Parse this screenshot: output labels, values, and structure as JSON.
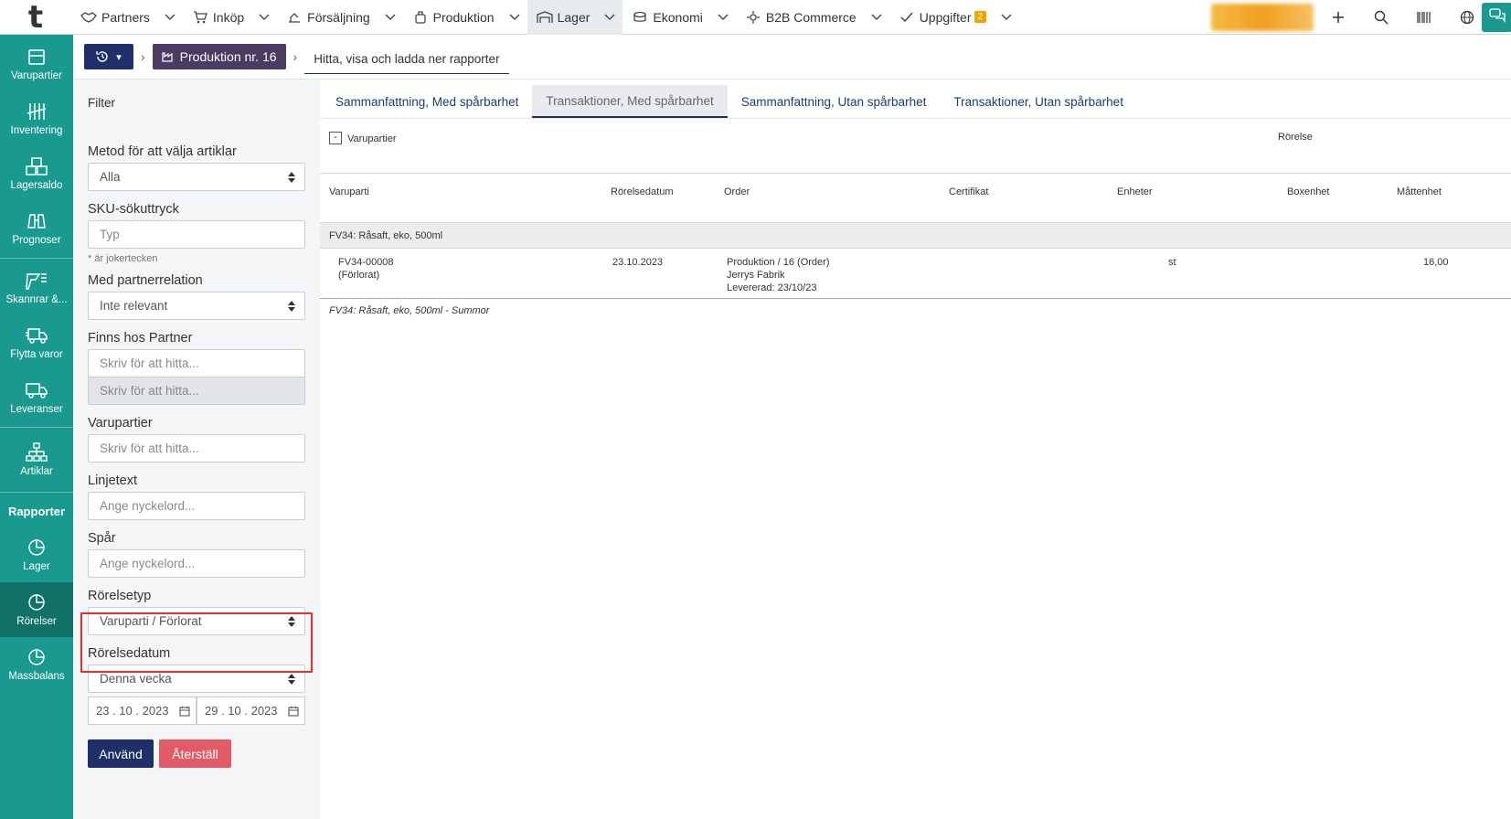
{
  "app": {
    "logo": "t"
  },
  "nav": {
    "items": [
      {
        "label": "Partners",
        "icon": "handshake-icon"
      },
      {
        "label": "Inköp",
        "icon": "cart-icon"
      },
      {
        "label": "Försäljning",
        "icon": "sales-icon"
      },
      {
        "label": "Produktion",
        "icon": "pot-icon"
      },
      {
        "label": "Lager",
        "icon": "warehouse-icon"
      },
      {
        "label": "Ekonomi",
        "icon": "coins-icon"
      },
      {
        "label": "B2B Commerce",
        "icon": "b2b-icon"
      },
      {
        "label": "Uppgifter",
        "icon": "check-icon",
        "badge": "2"
      }
    ],
    "active": "Lager"
  },
  "sidebar": {
    "items": [
      {
        "label": "Varupartier",
        "icon": "box-icon"
      },
      {
        "label": "Inventering",
        "icon": "tally-icon"
      },
      {
        "label": "Lagersaldo",
        "icon": "boxes-icon"
      },
      {
        "label": "Prognoser",
        "icon": "binoculars-icon"
      },
      {
        "label": "Skannrar &...",
        "icon": "scanner-icon"
      },
      {
        "label": "Flytta varor",
        "icon": "truck-move-icon"
      },
      {
        "label": "Leveranser",
        "icon": "truck-icon"
      },
      {
        "label": "Artiklar",
        "icon": "hierarchy-icon"
      }
    ],
    "reports_heading": "Rapporter",
    "report_items": [
      {
        "label": "Lager",
        "icon": "pie-chart-icon"
      },
      {
        "label": "Rörelser",
        "icon": "pie-chart-icon"
      },
      {
        "label": "Massbalans",
        "icon": "pie-chart-icon"
      }
    ],
    "active": "Rörelser"
  },
  "breadcrumb": {
    "production": "Produktion nr. 16",
    "current": "Hitta, visa och ladda ner rapporter"
  },
  "filter": {
    "title": "Filter",
    "method_label": "Metod för att välja artiklar",
    "method_value": "Alla",
    "sku_label": "SKU-sökuttryck",
    "sku_placeholder": "Typ",
    "sku_hint": "* är jokertecken",
    "partner_rel_label": "Med partnerrelation",
    "partner_rel_value": "Inte relevant",
    "at_partner_label": "Finns hos Partner",
    "at_partner_placeholder": "Skriv för att hitta...",
    "at_partner_placeholder2": "Skriv för att hitta...",
    "lots_label": "Varupartier",
    "lots_placeholder": "Skriv för att hitta...",
    "linetext_label": "Linjetext",
    "linetext_placeholder": "Ange nyckelord...",
    "trace_label": "Spår",
    "trace_placeholder": "Ange nyckelord...",
    "movetype_label": "Rörelsetyp",
    "movetype_value": "Varuparti / Förlorat",
    "movedate_label": "Rörelsedatum",
    "movedate_value": "Denna vecka",
    "date_from": "23 . 10 . 2023",
    "date_to": "29 . 10 . 2023",
    "apply": "Använd",
    "reset": "Återställ"
  },
  "tabs": [
    {
      "label": "Sammanfattning, Med spårbarhet"
    },
    {
      "label": "Transaktioner, Med spårbarhet"
    },
    {
      "label": "Sammanfattning, Utan spårbarhet"
    },
    {
      "label": "Transaktioner, Utan spårbarhet"
    }
  ],
  "report": {
    "toggle": "-",
    "group_header": "Varupartier",
    "movement_header": "Rörelse",
    "columns": [
      "Varuparti",
      "Rörelsedatum",
      "Order",
      "Certifikat",
      "Enheter",
      "Boxenhet",
      "Måttenhet"
    ],
    "group_title": "FV34: Råsaft, eko, 500ml",
    "row": {
      "lot": "FV34-00008",
      "lot_status": "(Förlorat)",
      "date": "23.10.2023",
      "order_line1": "Produktion / 16 (Order)",
      "order_line2": "Jerrys Fabrik",
      "order_line3": "Levererad: 23/10/23",
      "unit": "st",
      "value": "16,00"
    },
    "sum_title": "FV34: Råsaft, eko, 500ml - Summor"
  },
  "colors": {
    "primary": "#1a9a8f",
    "navy": "#1e2f6a",
    "danger": "#e05a67",
    "highlight": "#e03030"
  }
}
